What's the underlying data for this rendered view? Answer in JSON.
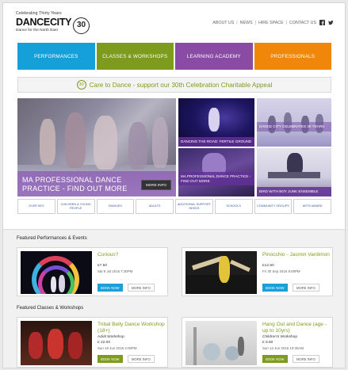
{
  "header": {
    "tagline": "Celebrating Thirty Years",
    "brand": "DANCECITY",
    "badge": "30",
    "subtitle": "Dance for the North East",
    "topnav": [
      "ABOUT US",
      "NEWS",
      "HIRE SPACE",
      "CONTACT US"
    ]
  },
  "mainnav": [
    {
      "label": "PERFORMANCES",
      "color": "#16a0d9"
    },
    {
      "label": "CLASSES & WORKSHOPS",
      "color": "#7d9b1c"
    },
    {
      "label": "LEARNING ACADEMY",
      "color": "#8a4ba5"
    },
    {
      "label": "PROFESSIONALS",
      "color": "#f0860a"
    }
  ],
  "appeal": {
    "badge": "30",
    "text": "Care to Dance - support our 30th Celebration Charitable Appeal"
  },
  "hero": {
    "big_line1": "MA PROFESSIONAL DANCE",
    "big_line2": "PRACTICE - FIND OUT MORE",
    "big_more": "MORE INFO",
    "tile1": "DANCING THE ROAD: FERTILE GROUND",
    "tile2": "DANCE CITY CELEBRATES 30 YEARS",
    "tile3": "MA PROFESSIONAL DANCE PRACTICE - FIND OUT MORE",
    "tile4": "BIRD WITH BOY JUNK ENSEMBLE"
  },
  "categories": [
    "OVER 55'S",
    "CHILDREN & YOUNG PEOPLE",
    "FAMILIES",
    "ADULTS",
    "ADDITIONAL SUPPORT NEEDS",
    "SCHOOLS",
    "COMMUNITY GROUPS",
    "ARTS AWARD"
  ],
  "featured_performances": {
    "heading": "Featured Performances & Events",
    "cards": [
      {
        "title": "Curious?",
        "price": "£7.50",
        "date": "Sat 9 Jul 2016 7:30PM",
        "book": "BOOK NOW",
        "info": "MORE INFO"
      },
      {
        "title": "Pinocchio - Jasmin Vardimon",
        "price": "£12.50",
        "date": "Fri 30 Sep 2016 8:00PM",
        "book": "BOOK NOW",
        "info": "MORE INFO"
      }
    ]
  },
  "featured_classes": {
    "heading": "Featured Classes & Workshops",
    "cards": [
      {
        "title": "Tribal Belly Dance Workshop (18+)",
        "kind": "Adult Workshop",
        "price": "£ 22.00",
        "date": "Sun 19 Jun 2016 2:00PM",
        "book": "BOOK NOW",
        "info": "MORE INFO"
      },
      {
        "title": "Hang Out and Dance (age - up to 10yrs)",
        "kind": "Children's Workshop",
        "price": "£ 5.50",
        "date": "Sun 12 Jun 2016 10:30AM",
        "book": "BOOK NOW",
        "info": "MORE INFO"
      }
    ]
  }
}
